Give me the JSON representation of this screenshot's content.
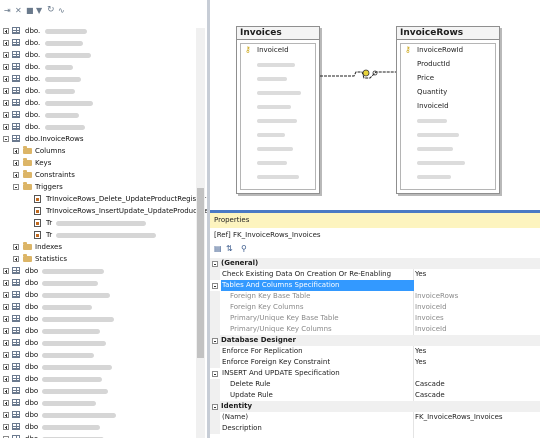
{
  "explorer": {
    "toolbar": [
      {
        "name": "connect-icon",
        "glyph": "⇥"
      },
      {
        "name": "disconnect-icon",
        "glyph": "✕"
      },
      {
        "name": "stop-icon",
        "glyph": "■"
      },
      {
        "name": "filter-icon",
        "glyph": "▼"
      },
      {
        "name": "refresh-icon",
        "glyph": "↻"
      },
      {
        "name": "activity-icon",
        "glyph": "∿"
      }
    ],
    "top_tables": [
      "dbo.",
      "dbo.",
      "dbo.",
      "dbo.",
      "dbo.",
      "dbo.",
      "dbo.",
      "dbo.",
      "dbo."
    ],
    "expanded_table": "dbo.InvoiceRows",
    "folders": {
      "columns": "Columns",
      "keys": "Keys",
      "constraints": "Constraints",
      "triggers": "Triggers",
      "indexes": "Indexes",
      "statistics": "Statistics"
    },
    "triggers": [
      "TrInvoiceRows_Delete_UpdateProductRegister",
      "TrInvoiceRows_InsertUpdate_UpdateProductReg",
      "Tr",
      "Tr"
    ],
    "bottom_tables": [
      "dbo",
      "dbo",
      "dbo",
      "dbo",
      "dbo",
      "dbo",
      "dbo",
      "dbo",
      "dbo",
      "dbo",
      "dbo",
      "dbo",
      "dbo",
      "dbo",
      "dbo",
      "dbo"
    ]
  },
  "diagram": {
    "invoices": {
      "title": "Invoices",
      "columns": [
        "InvoiceId"
      ]
    },
    "invoice_rows": {
      "title": "InvoiceRows",
      "columns": [
        "InvoiceRowId",
        "ProductId",
        "Price",
        "Quantity",
        "InvoiceId"
      ]
    }
  },
  "properties": {
    "title": "Properties",
    "object": "[Ref] FK_InvoiceRows_Invoices",
    "rows": [
      {
        "kind": "cat",
        "name": "(General)",
        "value": ""
      },
      {
        "kind": "prop",
        "name": "Check Existing Data On Creation Or Re-Enabling",
        "value": "Yes"
      },
      {
        "kind": "sel",
        "name": "Tables And Columns Specification",
        "value": ""
      },
      {
        "kind": "dim",
        "name": "Foreign Key Base Table",
        "value": "InvoiceRows"
      },
      {
        "kind": "dim",
        "name": "Foreign Key Columns",
        "value": "InvoiceId"
      },
      {
        "kind": "dim",
        "name": "Primary/Unique Key Base Table",
        "value": "Invoices"
      },
      {
        "kind": "dim",
        "name": "Primary/Unique Key Columns",
        "value": "InvoiceId"
      },
      {
        "kind": "cat",
        "name": "Database Designer",
        "value": ""
      },
      {
        "kind": "prop",
        "name": "Enforce For Replication",
        "value": "Yes"
      },
      {
        "kind": "prop",
        "name": "Enforce Foreign Key Constraint",
        "value": "Yes"
      },
      {
        "kind": "grp",
        "name": "INSERT And UPDATE Specification",
        "value": ""
      },
      {
        "kind": "sub",
        "name": "Delete Rule",
        "value": "Cascade"
      },
      {
        "kind": "sub",
        "name": "Update Rule",
        "value": "Cascade"
      },
      {
        "kind": "cat",
        "name": "Identity",
        "value": ""
      },
      {
        "kind": "prop",
        "name": "(Name)",
        "value": "FK_InvoiceRows_Invoices"
      },
      {
        "kind": "prop",
        "name": "Description",
        "value": ""
      }
    ]
  }
}
